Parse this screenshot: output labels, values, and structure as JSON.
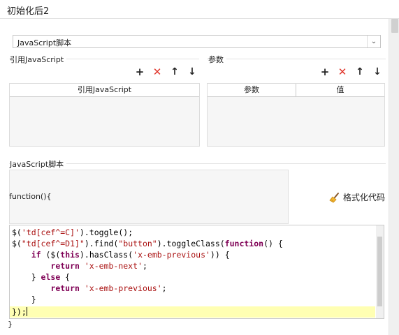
{
  "window": {
    "title": "初始化后2"
  },
  "script_type_select": {
    "value": "JavaScript脚本"
  },
  "ref_section": {
    "label": "引用JavaScript",
    "column_header": "引用JavaScript"
  },
  "params_section": {
    "label": "参数",
    "columns": [
      "参数",
      "值"
    ]
  },
  "toolbar_icons": [
    "plus-icon",
    "cross-icon",
    "arrow-up-icon",
    "arrow-down-icon"
  ],
  "script_section": {
    "label": "JavaScript脚本",
    "function_signature": "function(){",
    "closing_brace": "}"
  },
  "format_button": {
    "label": "格式化代码"
  },
  "colors": {
    "delete": "#e0352b",
    "active_line": "#ffffb3",
    "keyword": "#7f0055",
    "string": "#a11111"
  },
  "code": {
    "lines": [
      "$('td[cef^=C]').toggle();",
      "$(\"td[cef^=D1]\").find(\"button\").toggleClass(function() {",
      "    if ($(this).hasClass('x-emb-previous')) {",
      "        return 'x-emb-next';",
      "    } else {",
      "        return 'x-emb-previous';",
      "    }",
      "});"
    ]
  }
}
